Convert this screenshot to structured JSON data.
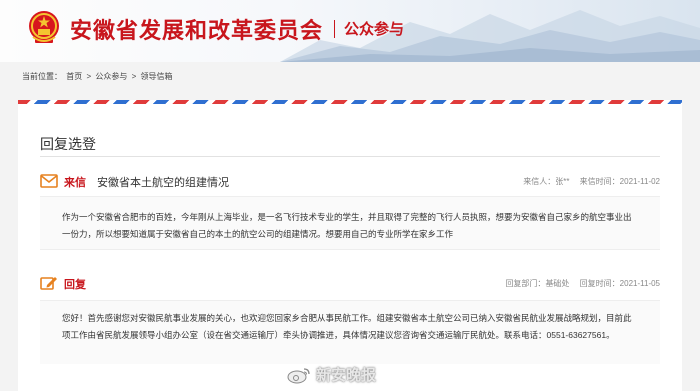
{
  "header": {
    "site_title": "安徽省发展和改革委员会",
    "section": "公众参与"
  },
  "breadcrumb": {
    "label": "当前位置：",
    "items": [
      "首页",
      "公众参与",
      "领导信箱"
    ],
    "separator": ">"
  },
  "card": {
    "title": "回复选登",
    "letter": {
      "label": "来信",
      "subject": "安徽省本土航空的组建情况",
      "sender_label": "来信人：",
      "sender": "张**",
      "date_label": "来信时间：",
      "date": "2021-11-02",
      "body": "作为一个安徽省合肥市的百姓，今年刚从上海毕业，是一名飞行技术专业的学生，并且取得了完整的飞行人员执照，想要为安徽省自己家乡的航空事业出一份力，所以想要知道属于安徽省自己的本土的航空公司的组建情况。想要用自己的专业所学在家乡工作"
    },
    "reply": {
      "label": "回复",
      "dept_label": "回复部门：",
      "dept": "基础处",
      "date_label": "回复时间：",
      "date": "2021-11-05",
      "body": "您好！首先感谢您对安徽民航事业发展的关心，也欢迎您回家乡合肥从事民航工作。组建安徽省本土航空公司已纳入安徽省民航业发展战略规划，目前此项工作由省民航发展领导小组办公室（设在省交通运输厅）牵头协调推进，具体情况建议您咨询省交通运输厅民航处。联系电话：0551-63627561。"
    }
  },
  "watermark": {
    "text": "新安晚报"
  },
  "colors": {
    "brand_red": "#c8161d",
    "airmail_red": "#e03b3b",
    "airmail_blue": "#2f6fd1"
  },
  "icons": {
    "emblem": "national-emblem-icon",
    "letter": "envelope-icon",
    "reply": "reply-edit-icon",
    "watermark": "weibo-logo-icon"
  }
}
